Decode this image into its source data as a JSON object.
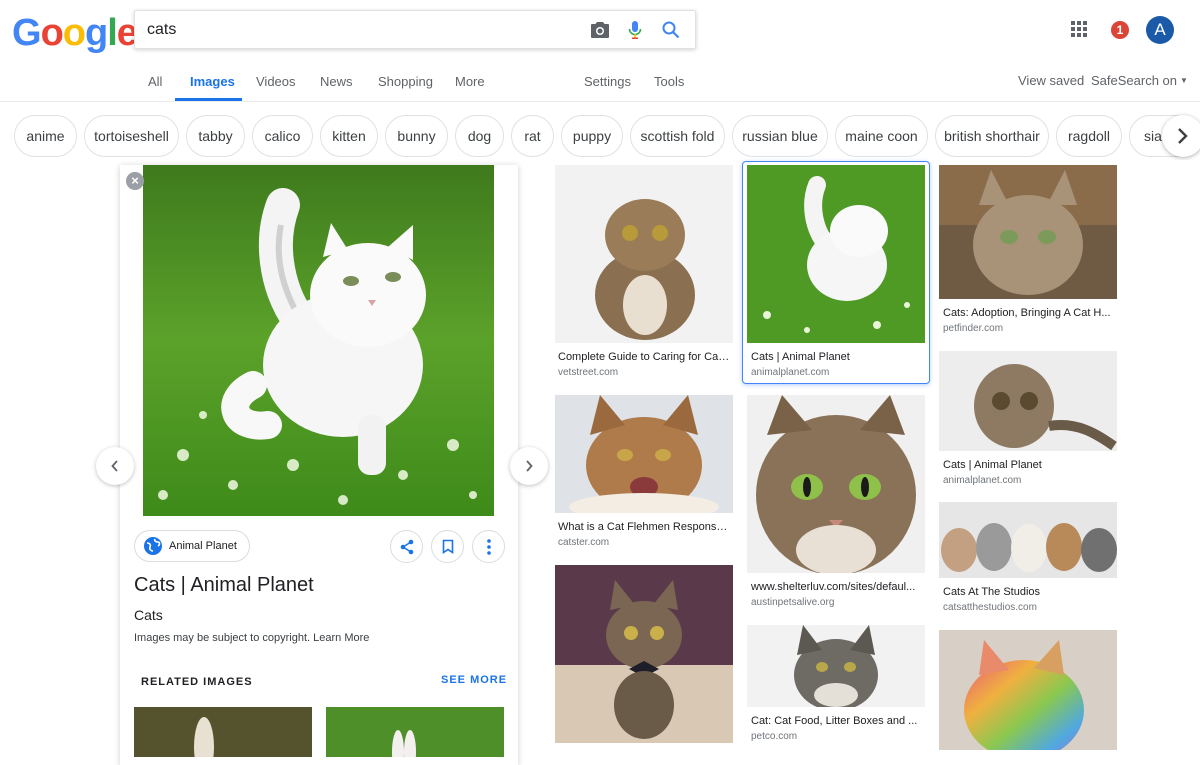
{
  "header": {
    "logo_letters": [
      {
        "ch": "G",
        "color": "#4285F4"
      },
      {
        "ch": "o",
        "color": "#EA4335"
      },
      {
        "ch": "o",
        "color": "#FBBC05"
      },
      {
        "ch": "g",
        "color": "#4285F4"
      },
      {
        "ch": "l",
        "color": "#34A853"
      },
      {
        "ch": "e",
        "color": "#EA4335"
      }
    ],
    "search_value": "cats",
    "notification_count": "1",
    "avatar_letter": "A",
    "icons": [
      "camera-icon",
      "microphone-icon",
      "search-icon",
      "apps-grid-icon"
    ]
  },
  "nav": {
    "tabs": [
      {
        "label": "All",
        "active": false
      },
      {
        "label": "Images",
        "active": true
      },
      {
        "label": "Videos",
        "active": false
      },
      {
        "label": "News",
        "active": false
      },
      {
        "label": "Shopping",
        "active": false
      },
      {
        "label": "More",
        "active": false
      }
    ],
    "settings_label": "Settings",
    "tools_label": "Tools",
    "view_saved_label": "View saved",
    "safesearch_label": "SafeSearch on"
  },
  "chips": [
    "anime",
    "tortoiseshell",
    "tabby",
    "calico",
    "kitten",
    "bunny",
    "dog",
    "rat",
    "puppy",
    "scottish fold",
    "russian blue",
    "maine coon",
    "british shorthair",
    "ragdoll",
    "siamese"
  ],
  "panel": {
    "source_label": "Animal Planet",
    "title": "Cats | Animal Planet",
    "subtitle": "Cats",
    "copyright": "Images may be subject to copyright. Learn More",
    "related_label": "RELATED IMAGES",
    "see_more_label": "SEE MORE"
  },
  "results": [
    {
      "title": "Complete Guide to Caring for Cat...",
      "site": "vetstreet.com"
    },
    {
      "title": "Cats | Animal Planet",
      "site": "animalplanet.com"
    },
    {
      "title": "Cats: Adoption, Bringing A Cat H...",
      "site": "petfinder.com"
    },
    {
      "title": "Cats | Animal Planet",
      "site": "animalplanet.com"
    },
    {
      "title": "What is a Cat Flehmen Response...",
      "site": "catster.com"
    },
    {
      "title": "www.shelterluv.com/sites/defaul...",
      "site": "austinpetsalive.org"
    },
    {
      "title": "Cats At The Studios",
      "site": "catsatthestudios.com"
    },
    {
      "title": "Cat: Cat Food, Litter Boxes and ...",
      "site": "petco.com"
    }
  ]
}
